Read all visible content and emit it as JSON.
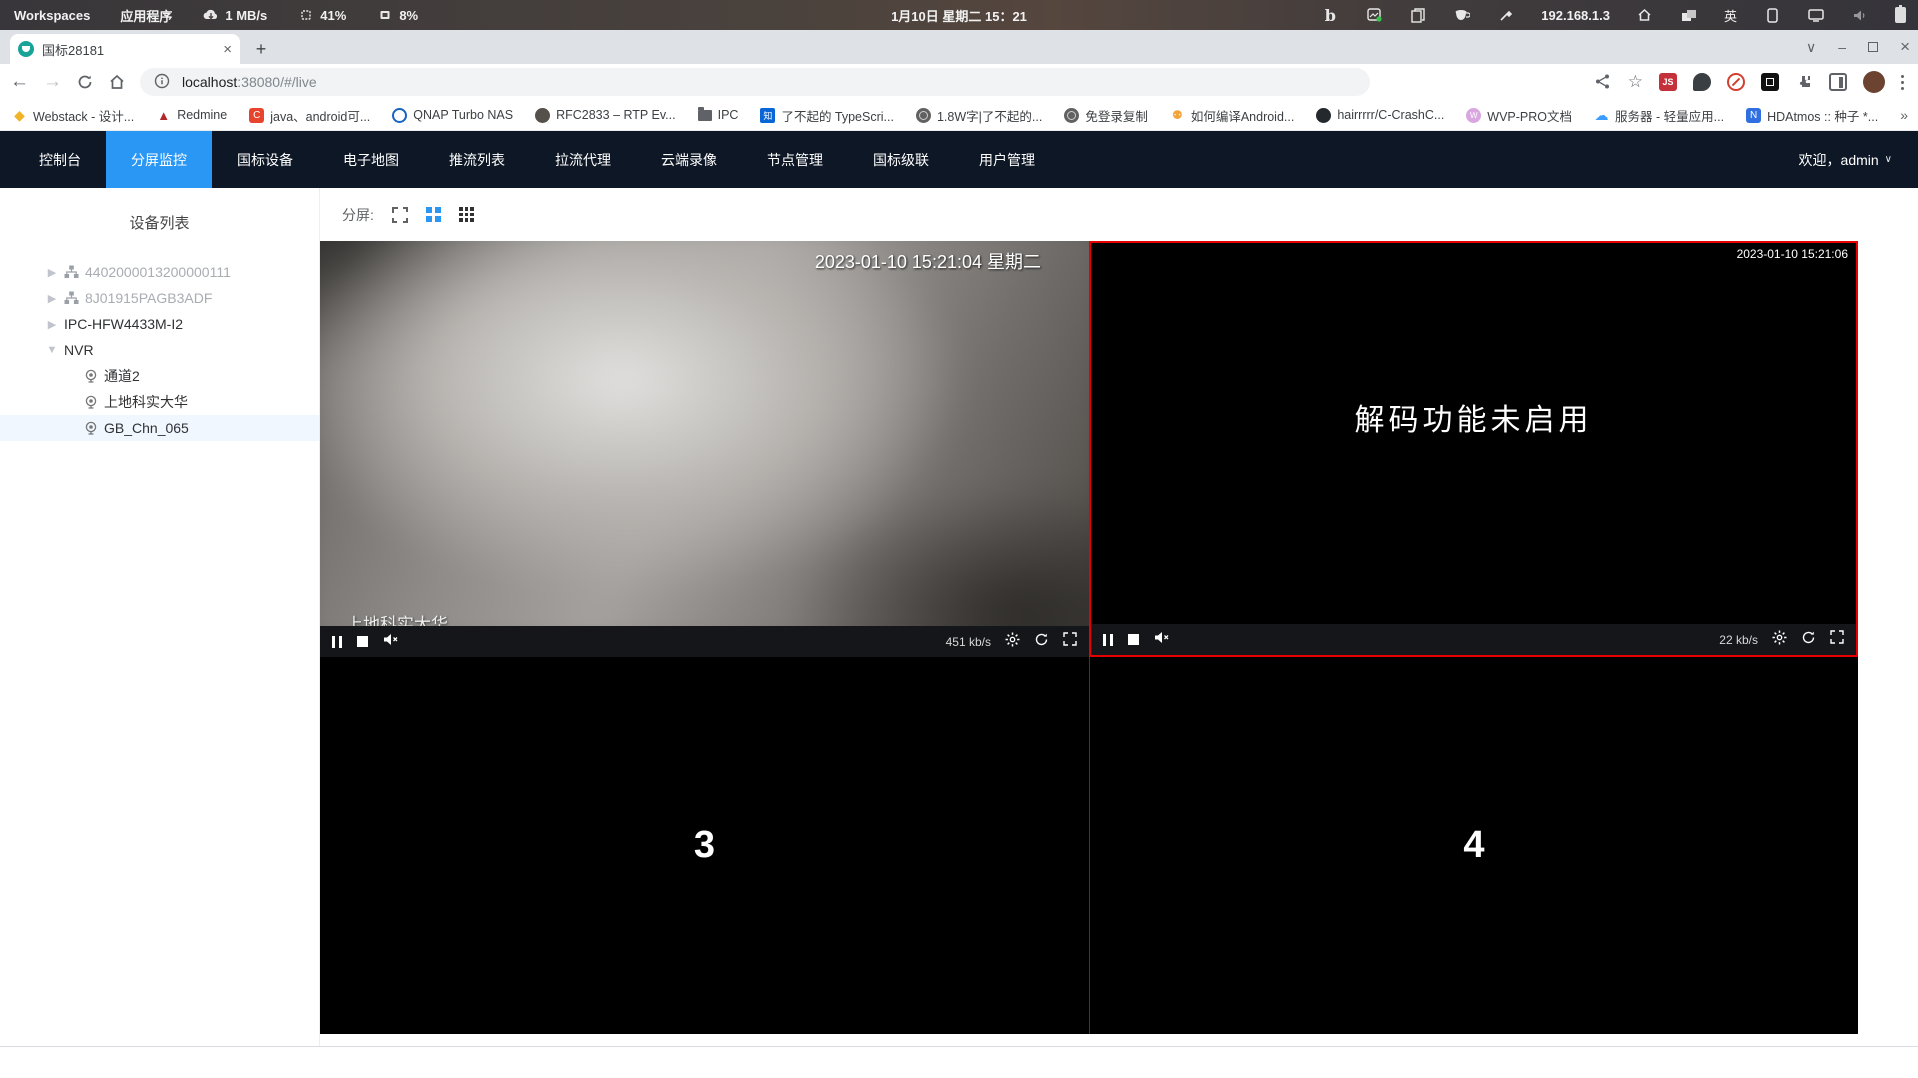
{
  "colors": {
    "accent": "#2a97f5",
    "nav-bg": "#0e1725",
    "red": "#e60000",
    "sel": "#f0f7ff"
  },
  "system_bar": {
    "workspaces": "Workspaces",
    "applications": "应用程序",
    "network_speed": "1 MB/s",
    "cpu": "41%",
    "memory": "8%",
    "clock": "1月10日 星期二 15：21",
    "ip": "192.168.1.3",
    "input_method": "英"
  },
  "browser": {
    "tab": {
      "title": "国标28181",
      "close": "×",
      "new_tab": "+"
    },
    "address": {
      "url_host": "localhost",
      "url_rest": ":38080/#/live"
    },
    "extensions": {
      "js_label": "JS"
    },
    "bookmarks": [
      {
        "label": "Webstack - 设计..."
      },
      {
        "label": "Redmine"
      },
      {
        "label": "java、android可...",
        "icon_text": "C"
      },
      {
        "label": "QNAP Turbo NAS"
      },
      {
        "label": "RFC2833 – RTP Ev..."
      },
      {
        "label": "IPC"
      },
      {
        "label": "了不起的 TypeScri...",
        "icon_text": "知"
      },
      {
        "label": "1.8W字|了不起的..."
      },
      {
        "label": "免登录复制"
      },
      {
        "label": "如何编译Android..."
      },
      {
        "label": "hairrrrr/C-CrashC..."
      },
      {
        "label": "WVP-PRO文档",
        "icon_text": "W"
      },
      {
        "label": "服务器 - 轻量应用...",
        "icon_text": "☁"
      },
      {
        "label": "HDAtmos :: 种子 *...",
        "icon_text": "N"
      }
    ],
    "overflow": "»"
  },
  "nav": {
    "items": [
      "控制台",
      "分屏监控",
      "国标设备",
      "电子地图",
      "推流列表",
      "拉流代理",
      "云端录像",
      "节点管理",
      "国标级联",
      "用户管理"
    ],
    "welcome": "欢迎，admin"
  },
  "sidebar": {
    "title": "设备列表",
    "nodes": [
      {
        "label": "4402000013200000111"
      },
      {
        "label": "8J01915PAGB3ADF"
      },
      {
        "label": "IPC-HFW4433M-I2"
      },
      {
        "label": "NVR"
      }
    ],
    "channels": [
      {
        "label": "通道2"
      },
      {
        "label": "上地科实大华"
      },
      {
        "label": "GB_Chn_065"
      }
    ]
  },
  "toolbar": {
    "split_label": "分屏:"
  },
  "players": {
    "cell1": {
      "timestamp": "2023-01-10 15:21:04 星期二",
      "camera_name": "上地科实大华",
      "bitrate": "451 kb/s"
    },
    "cell2": {
      "message": "解码功能未启用",
      "timestamp": "2023-01-10 15:21:06",
      "bitrate": "22 kb/s"
    },
    "cell3": {
      "number": "3"
    },
    "cell4": {
      "number": "4"
    }
  }
}
